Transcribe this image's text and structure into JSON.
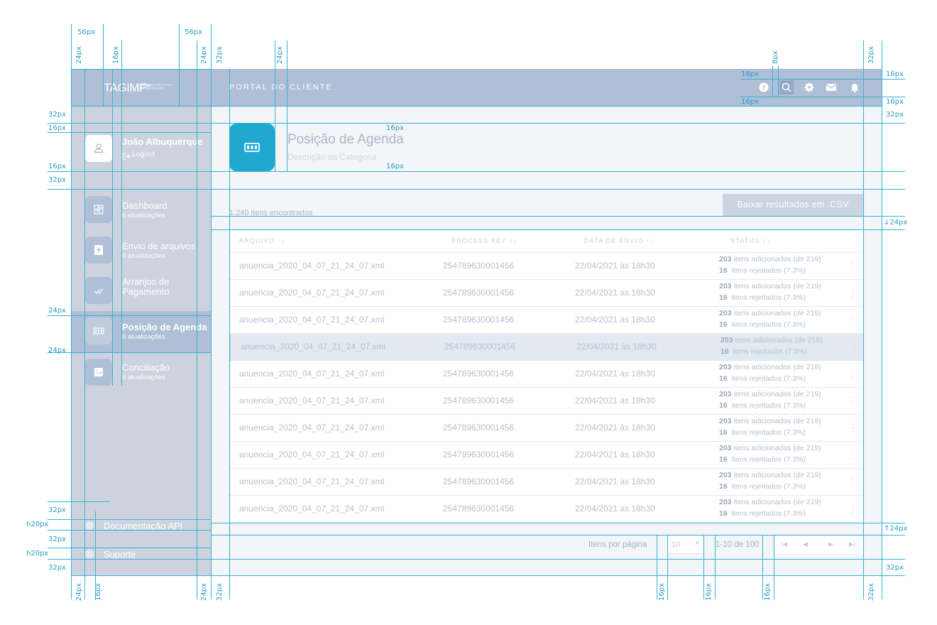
{
  "app": {
    "logo": "TAGIMF",
    "logo_sub_1": "INFRAESTRUTURA",
    "logo_sub_2": "DE MERCADO",
    "portal_title": "PORTAL DO CLIENTE"
  },
  "topbar_icons": [
    "help-icon",
    "search-icon",
    "gear-icon",
    "mail-icon",
    "bell-icon"
  ],
  "user": {
    "name": "João Albuquerque",
    "logout_label": "Logout"
  },
  "nav": [
    {
      "label": "Dashboard",
      "sub": "6 atualizações",
      "icon": "dashboard-icon"
    },
    {
      "label": "Envio de arquivos",
      "sub": "6 atualizações",
      "icon": "upload-icon"
    },
    {
      "label": "Arranjos de Pagamento",
      "sub": "",
      "icon": "check-icon"
    },
    {
      "label": "Posição de Agenda",
      "sub": "6 atualizações",
      "icon": "agenda-icon",
      "active": true
    },
    {
      "label": "Conciliação",
      "sub": "6 atualizações",
      "icon": "reconcile-icon"
    }
  ],
  "bottom_links": {
    "docs": "Documentação API",
    "support": "Suporte"
  },
  "category": {
    "title": "Posição de Agenda",
    "description": "Descrição da Categoria"
  },
  "results": {
    "count_text": "1.240 itens encontrados",
    "csv_button": "Baixar resultados em .CSV"
  },
  "table": {
    "columns": [
      "ARQUIVO",
      "PROCESS KEY",
      "DATA DE ENVIO",
      "STATUS"
    ],
    "sort_glyph": "↑↓",
    "rows": [
      {
        "file": "anuencia_2020_04_07_21_24_07.xml",
        "key": "254789630001456",
        "date": "22/04/2021 às 18h30",
        "added_n": "203",
        "added_t": "itens adicionados (de 219)",
        "rej_n": "16",
        "rej_t": "itens rejeitados (7.3%)"
      },
      {
        "file": "anuencia_2020_04_07_21_24_07.xml",
        "key": "254789630001456",
        "date": "22/04/2021 às 18h30",
        "added_n": "203",
        "added_t": "itens adicionados (de 219)",
        "rej_n": "16",
        "rej_t": "itens rejeitados (7.3%)"
      },
      {
        "file": "anuencia_2020_04_07_21_24_07.xml",
        "key": "254789630001456",
        "date": "22/04/2021 às 18h30",
        "added_n": "203",
        "added_t": "itens adicionados (de 219)",
        "rej_n": "16",
        "rej_t": "itens rejeitados (7.3%)"
      },
      {
        "file": "anuencia_2020_04_07_21_24_07.xml",
        "key": "254789630001456",
        "date": "22/04/2021 às 18h30",
        "added_n": "203",
        "added_t": "itens adicionados (de 219)",
        "rej_n": "16",
        "rej_t": "itens rejeitados (7.3%)"
      },
      {
        "file": "anuencia_2020_04_07_21_24_07.xml",
        "key": "254789630001456",
        "date": "22/04/2021 às 18h30",
        "added_n": "203",
        "added_t": "itens adicionados (de 219)",
        "rej_n": "16",
        "rej_t": "itens rejeitados (7.3%)"
      },
      {
        "file": "anuencia_2020_04_07_21_24_07.xml",
        "key": "254789630001456",
        "date": "22/04/2021 às 18h30",
        "added_n": "203",
        "added_t": "itens adicionados (de 219)",
        "rej_n": "16",
        "rej_t": "itens rejeitados (7.3%)"
      },
      {
        "file": "anuencia_2020_04_07_21_24_07.xml",
        "key": "254789630001456",
        "date": "22/04/2021 às 18h30",
        "added_n": "203",
        "added_t": "itens adicionados (de 219)",
        "rej_n": "16",
        "rej_t": "itens rejeitados (7.3%)"
      },
      {
        "file": "anuencia_2020_04_07_21_24_07.xml",
        "key": "254789630001456",
        "date": "22/04/2021 às 18h30",
        "added_n": "203",
        "added_t": "itens adicionados (de 219)",
        "rej_n": "16",
        "rej_t": "itens rejeitados (7.3%)"
      },
      {
        "file": "anuencia_2020_04_07_21_24_07.xml",
        "key": "254789630001456",
        "date": "22/04/2021 às 18h30",
        "added_n": "203",
        "added_t": "itens adicionados (de 219)",
        "rej_n": "16",
        "rej_t": "itens rejeitados (7.3%)"
      },
      {
        "file": "anuencia_2020_04_07_21_24_07.xml",
        "key": "254789630001456",
        "date": "22/04/2021 às 18h30",
        "added_n": "203",
        "added_t": "itens adicionados (de 219)",
        "rej_n": "16",
        "rej_t": "itens rejeitados (7.3%)"
      }
    ]
  },
  "pagination": {
    "label": "Itens por página",
    "per_page": "10",
    "range": "1-10 de 100"
  },
  "spec_labels": {
    "p56": "56px",
    "p24": "24px",
    "p16": "16px",
    "p32": "32px",
    "p8": "8px",
    "h20": "h20px",
    "down24": "↓24px",
    "up24": "↑24px"
  },
  "colors": {
    "header": "#aebfd6",
    "sidebar": "#cdd3de",
    "accent": "#1fa8d0",
    "guide": "#35b2d4"
  }
}
